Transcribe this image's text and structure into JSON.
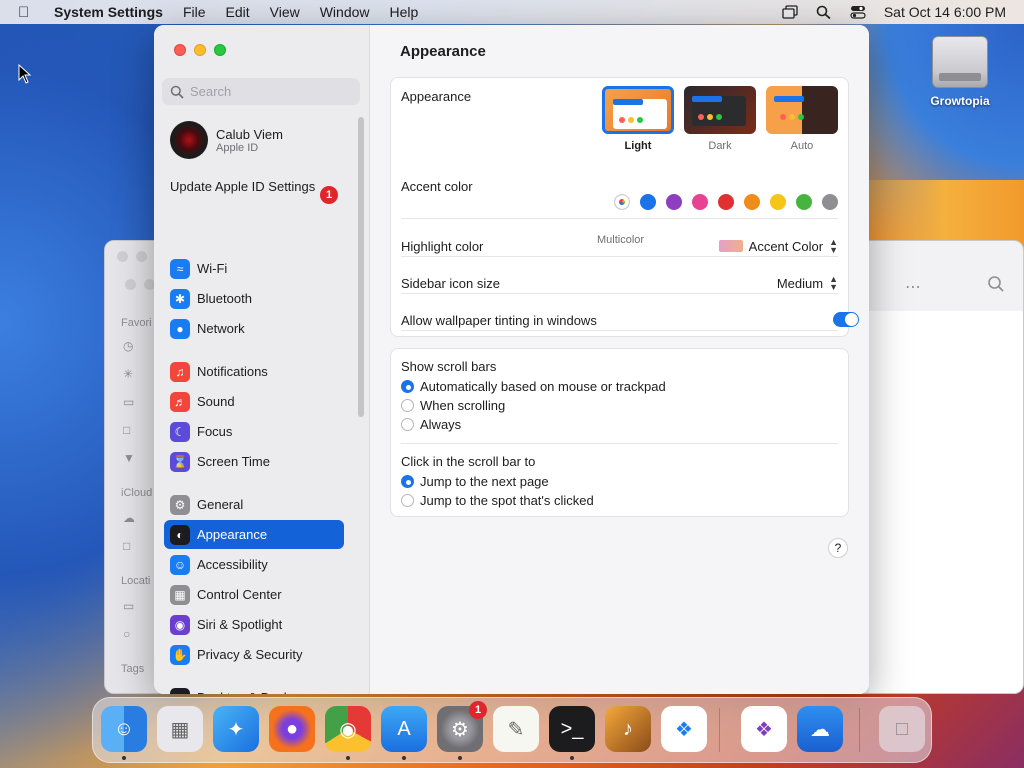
{
  "menubar": {
    "app": "System Settings",
    "menus": [
      "File",
      "Edit",
      "View",
      "Window",
      "Help"
    ],
    "datetime": "Sat Oct 14  6:00 PM"
  },
  "desktop": {
    "icon_label": "Growtopia"
  },
  "finder": {
    "favorites": "Favori",
    "icloud": "iCloud",
    "locations": "Locati",
    "tags": "Tags"
  },
  "sidebar": {
    "search_placeholder": "Search",
    "account_name": "Calub Viem",
    "account_sub": "Apple ID",
    "update_label": "Update Apple ID Settings",
    "update_badge": "1",
    "items": [
      {
        "label": "Wi-Fi",
        "icon": "wifi-icon",
        "color": "#1a7cf2"
      },
      {
        "label": "Bluetooth",
        "icon": "bluetooth-icon",
        "color": "#1a7cf2"
      },
      {
        "label": "Network",
        "icon": "globe-icon",
        "color": "#1a7cf2"
      },
      {
        "label": "Notifications",
        "icon": "bell-icon",
        "color": "#f0463c"
      },
      {
        "label": "Sound",
        "icon": "speaker-icon",
        "color": "#f0463c"
      },
      {
        "label": "Focus",
        "icon": "moon-icon",
        "color": "#5c4ad8"
      },
      {
        "label": "Screen Time",
        "icon": "hourglass-icon",
        "color": "#5c4ad8"
      },
      {
        "label": "General",
        "icon": "gear-icon",
        "color": "#8e8e93"
      },
      {
        "label": "Appearance",
        "icon": "appearance-icon",
        "color": "#1c1c1e"
      },
      {
        "label": "Accessibility",
        "icon": "accessibility-icon",
        "color": "#1a7cf2"
      },
      {
        "label": "Control Center",
        "icon": "control-center-icon",
        "color": "#8e8e93"
      },
      {
        "label": "Siri & Spotlight",
        "icon": "siri-icon",
        "color": "#6a3fd0"
      },
      {
        "label": "Privacy & Security",
        "icon": "hand-icon",
        "color": "#1a7cf2"
      },
      {
        "label": "Desktop & Dock",
        "icon": "dock-icon",
        "color": "#1c1c1e"
      }
    ]
  },
  "content": {
    "title": "Appearance",
    "appearance_label": "Appearance",
    "modes": [
      "Light",
      "Dark",
      "Auto"
    ],
    "accent_label": "Accent color",
    "accent_colors": [
      "#8e44ad",
      "#1a73e8",
      "#8e3fbf",
      "#e84393",
      "#e03131",
      "#f08c1a",
      "#f5c518",
      "#47b43f",
      "#8e8e93"
    ],
    "multicolor_label": "Multicolor",
    "highlight_label": "Highlight color",
    "highlight_value": "Accent Color",
    "icon_size_label": "Sidebar icon size",
    "icon_size_value": "Medium",
    "tinting_label": "Allow wallpaper tinting in windows",
    "scroll_title": "Show scroll bars",
    "scroll_options": [
      "Automatically based on mouse or trackpad",
      "When scrolling",
      "Always"
    ],
    "click_title": "Click in the scroll bar to",
    "click_options": [
      "Jump to the next page",
      "Jump to the spot that's clicked"
    ],
    "help": "?"
  },
  "dock": {
    "apps": [
      "finder-icon",
      "launchpad-icon",
      "safari-icon",
      "firefox-icon",
      "chrome-icon",
      "app-store-icon",
      "system-settings-icon",
      "textedit-icon",
      "terminal-icon",
      "garageband-icon",
      "vscode-icon",
      "visual-studio-icon",
      "weather-icon",
      "trash-icon"
    ],
    "settings_badge": "1"
  }
}
